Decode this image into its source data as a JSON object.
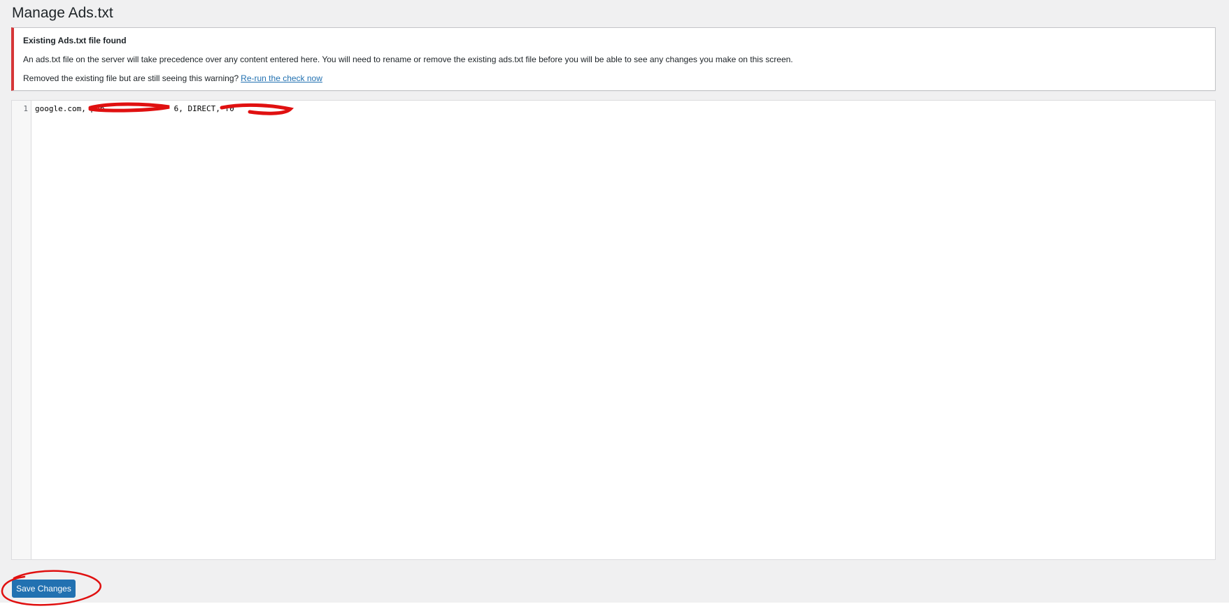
{
  "page": {
    "title": "Manage Ads.txt"
  },
  "notice": {
    "title": "Existing Ads.txt file found",
    "message": "An ads.txt file on the server will take precedence over any content entered here. You will need to rename or remove the existing ads.txt file before you will be able to see any changes you make on this screen.",
    "prompt": "Removed the existing file but are still seeing this warning?",
    "link_label": "Re-run the check now",
    "border_color": "#d63638"
  },
  "editor": {
    "line_numbers": [
      "1"
    ],
    "content": "google.com, pub-              6, DIRECT, f0"
  },
  "actions": {
    "save_label": "Save Changes",
    "button_color": "#2271b1"
  },
  "annotations": {
    "marker_color": "#e01010"
  }
}
